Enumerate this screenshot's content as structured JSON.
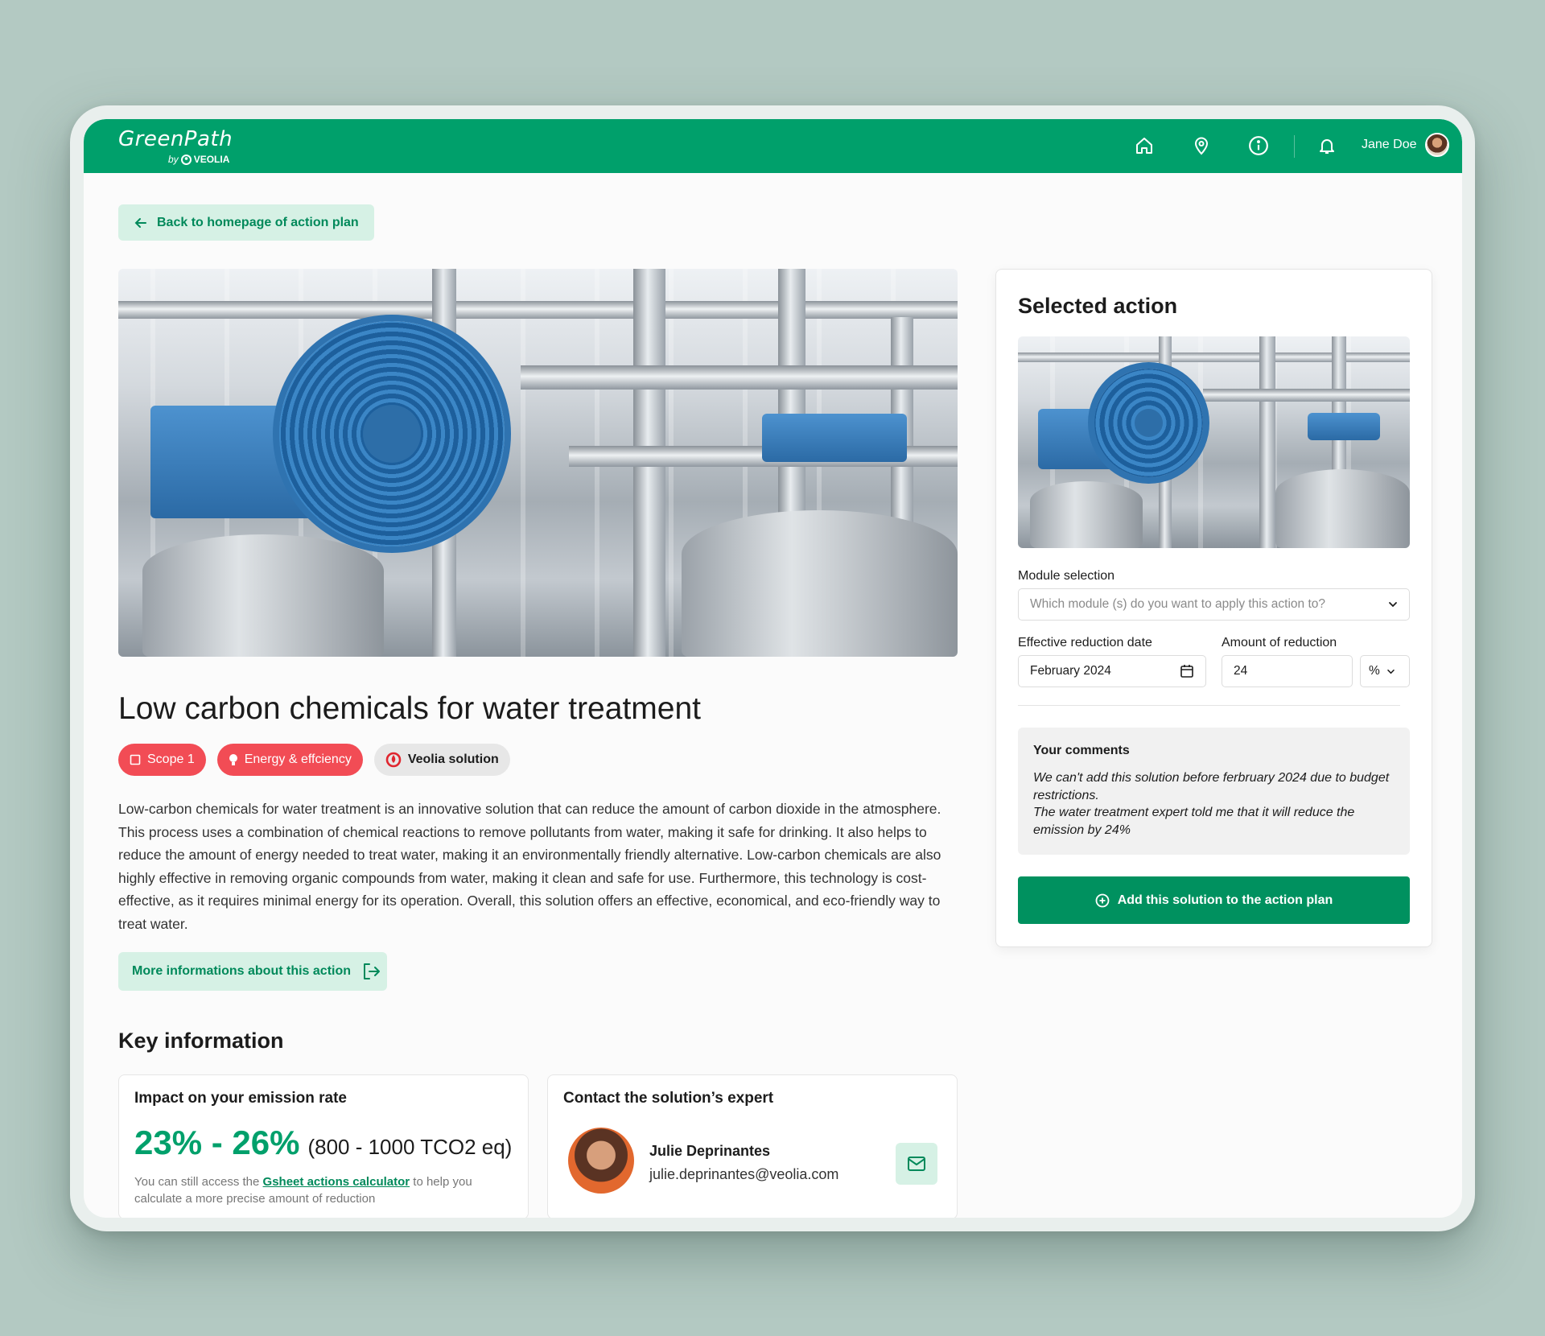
{
  "brand": {
    "name": "GreenPath",
    "by": "by",
    "company": "VEOLIA"
  },
  "header": {
    "user_name": "Jane Doe"
  },
  "back_button": {
    "label": "Back to homepage of action plan"
  },
  "action": {
    "title": "Low carbon chemicals for water treatment",
    "tags": [
      "Scope 1",
      "Energy & effciency",
      "Veolia solution"
    ],
    "description": "Low-carbon chemicals for water treatment is an innovative solution that can reduce the amount of carbon dioxide in the atmosphere. This process uses a combination of chemical reactions to remove pollutants from water, making it safe for drinking. It also helps to reduce the amount of energy needed to treat water, making it an environmentally friendly alternative. Low-carbon chemicals are also highly effective in removing organic compounds from water, making it clean and safe for use. Furthermore, this technology is cost-effective, as it requires minimal energy for its operation. Overall, this solution offers an effective, economical, and eco-friendly way to treat water.",
    "more_info_label": "More informations about this action"
  },
  "key_info": {
    "title": "Key information",
    "impact": {
      "title": "Impact on your emission rate",
      "percent_range": "23% - 26%",
      "tco2_range": "(800 - 1000 TCO2 eq)",
      "note_before": "You can still access the ",
      "note_link": "Gsheet actions calculator",
      "note_after": " to help you calculate a more precise amount of reduction"
    },
    "contact": {
      "title": "Contact the solution’s expert",
      "name": "Julie Deprinantes",
      "email": "julie.deprinantes@veolia.com"
    }
  },
  "side_panel": {
    "title": "Selected action",
    "module_label": "Module selection",
    "module_placeholder": "Which module (s) do you want to apply this action to?",
    "date_label": "Effective reduction date",
    "date_value": "February 2024",
    "amount_label": "Amount of reduction",
    "amount_value": "24",
    "unit_value": "%",
    "comments_title": "Your comments",
    "comments_line1": "We can't add this solution before ferbruary 2024 due to budget restrictions.",
    "comments_line2": "The water treatment expert told me that it will reduce the emission by 24%",
    "add_button": "Add this solution to the action plan"
  },
  "colors": {
    "brand_green": "#00a06b",
    "tag_red": "#f24c55",
    "accent_mint": "#d6f1e5"
  }
}
